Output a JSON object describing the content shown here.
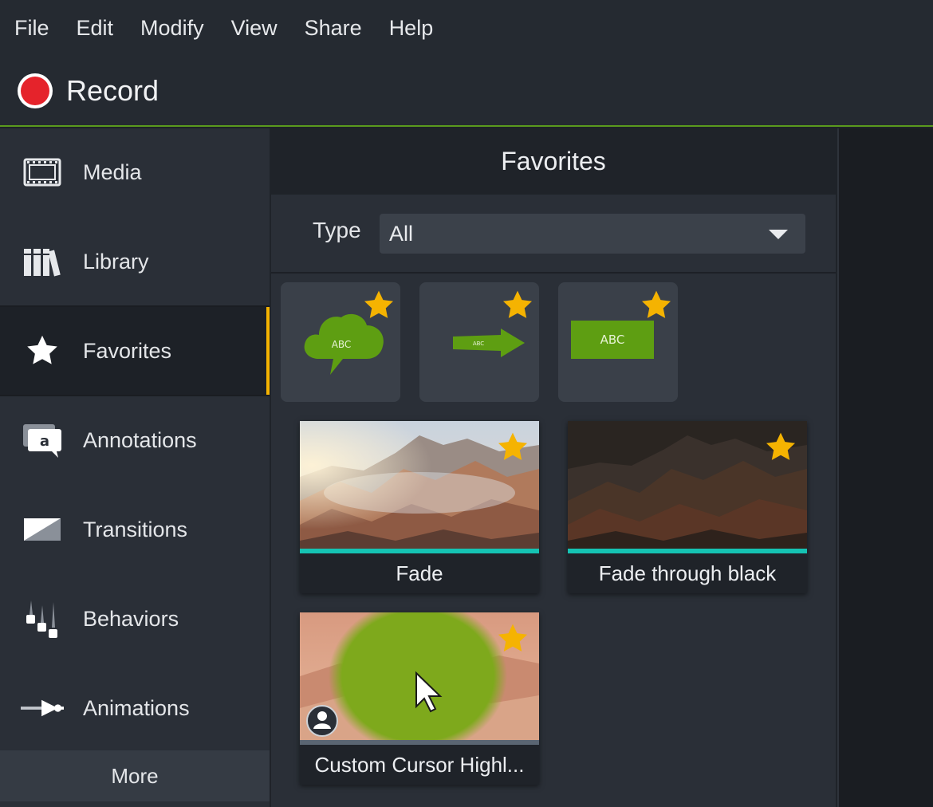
{
  "menu": [
    "File",
    "Edit",
    "Modify",
    "View",
    "Share",
    "Help"
  ],
  "record": {
    "label": "Record"
  },
  "sidebar": {
    "items": [
      {
        "label": "Media",
        "icon": "film-icon"
      },
      {
        "label": "Library",
        "icon": "books-icon"
      },
      {
        "label": "Favorites",
        "icon": "star-icon",
        "active": true
      },
      {
        "label": "Annotations",
        "icon": "callout-icon"
      },
      {
        "label": "Transitions",
        "icon": "transition-icon"
      },
      {
        "label": "Behaviors",
        "icon": "behaviors-icon"
      },
      {
        "label": "Animations",
        "icon": "animation-arrow-icon"
      }
    ],
    "more_label": "More"
  },
  "panel": {
    "title": "Favorites",
    "type_label": "Type",
    "type_value": "All",
    "annotation_tiles": [
      {
        "name": "cloud-callout",
        "text": "ABC"
      },
      {
        "name": "arrow-callout",
        "text": "ABC"
      },
      {
        "name": "rectangle-callout",
        "text": "ABC"
      }
    ],
    "cards": [
      {
        "label": "Fade"
      },
      {
        "label": "Fade through black"
      },
      {
        "label": "Custom Cursor Highl..."
      }
    ]
  },
  "colors": {
    "accent_green": "#5a9a1d",
    "record_red": "#e5232b",
    "star_gold": "#f5b301",
    "teal": "#15c3b3"
  }
}
